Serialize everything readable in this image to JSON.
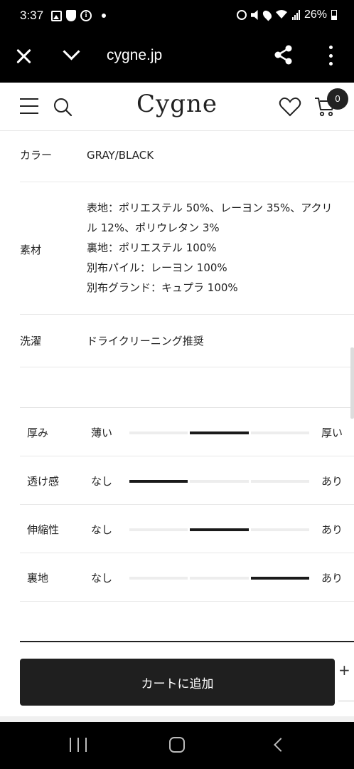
{
  "status_bar": {
    "time": "3:37",
    "battery": "26%",
    "icons_left": [
      "image-icon",
      "shield-icon",
      "info-icon",
      "dot-icon"
    ],
    "icons_right": [
      "alarm-icon",
      "mute-icon",
      "location-icon",
      "wifi-icon",
      "signal-icon",
      "battery-icon"
    ]
  },
  "browser": {
    "url": "cygne.jp",
    "icons": [
      "close-icon",
      "chevron-down-icon",
      "share-icon",
      "more-vert-icon"
    ]
  },
  "header": {
    "logo": "Cygne",
    "cart_count": "0",
    "icons": [
      "hamburger-icon",
      "search-icon",
      "heart-icon",
      "cart-icon"
    ]
  },
  "specs": {
    "color": {
      "label": "カラー",
      "value": "GRAY/BLACK"
    },
    "material": {
      "label": "素材",
      "lines": [
        "表地：ポリエステル 50%、レーヨン 35%、アクリ",
        "ル 12%、ポリウレタン 3%",
        "裏地：ポリエステル 100%",
        "別布パイル：レーヨン 100%",
        "別布グランド：キュプラ 100%"
      ]
    },
    "care": {
      "label": "洗濯",
      "value": "ドライクリーニング推奨"
    }
  },
  "characteristics": [
    {
      "name": "厚み",
      "min": "薄い",
      "max": "厚い",
      "level": 2,
      "levels": 3
    },
    {
      "name": "透け感",
      "min": "なし",
      "max": "あり",
      "level": 1,
      "levels": 3
    },
    {
      "name": "伸縮性",
      "min": "なし",
      "max": "あり",
      "level": 2,
      "levels": 3
    },
    {
      "name": "裏地",
      "min": "なし",
      "max": "あり",
      "level": 3,
      "levels": 3
    }
  ],
  "cart": {
    "add_label": "カートに追加",
    "plus_label": "+"
  },
  "nav": {
    "icons": [
      "recents-icon",
      "home-icon",
      "back-icon"
    ]
  }
}
